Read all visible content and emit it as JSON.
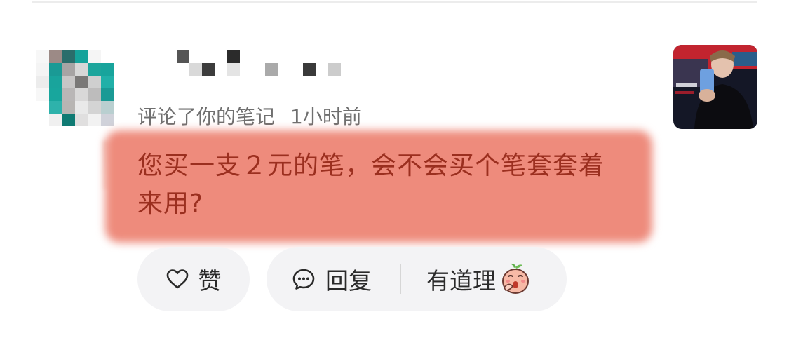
{
  "comment": {
    "action_text": "评论了你的笔记",
    "time": "1小时前",
    "text": "您买一支２元的笔，会不会买个笔套套着来用?"
  },
  "actions": {
    "like_label": "赞",
    "reply_label": "回复",
    "quick_reply_label": "有道理"
  },
  "icons": {
    "like": "heart-outline-icon",
    "reply": "speech-bubble-icon",
    "quick_reply_emoji": "peach-emoji-icon"
  },
  "colors": {
    "highlight": "#ee8b7c",
    "comment_text": "#9b2f1f",
    "meta_text": "#6f6f6f",
    "pill_bg": "#f3f3f5"
  }
}
